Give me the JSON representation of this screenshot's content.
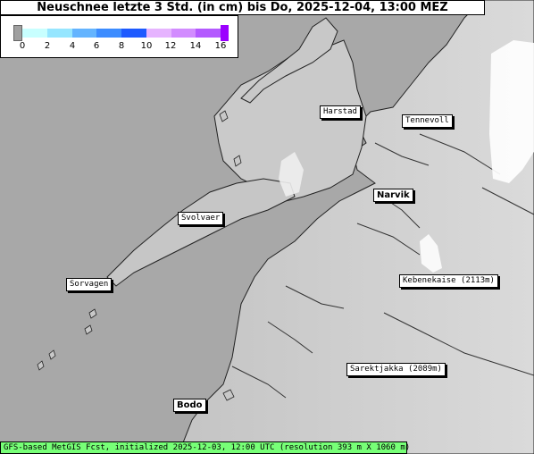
{
  "title": "Neuschnee letzte 3 Std. (in cm) bis Do, 2025-12-04, 13:00 MEZ",
  "legend": {
    "ticks": [
      "0",
      "2",
      "4",
      "6",
      "8",
      "10",
      "12",
      "14",
      "16"
    ],
    "colors": [
      "#c8ffff",
      "#96e6ff",
      "#64b4ff",
      "#3c8cff",
      "#1e5aff",
      "#e6b4ff",
      "#d28cff",
      "#b45aff",
      "#9b00ff"
    ]
  },
  "places": {
    "harstad": "Harstad",
    "tennevoll": "Tennevoll",
    "narvik": "Narvik",
    "svolvaer": "Svolvaer",
    "sorvagen": "Sorvagen",
    "kebnekaise": "Kebenekaise (2113m)",
    "sarektjakka": "Sarektjakka (2089m)",
    "bodo": "Bodo"
  },
  "footer": "GFS-based MetGIS Fcst, initialized 2025-12-03, 12:00 UTC  (resolution 393 m X 1060 m)",
  "colors": {
    "sea": "#a8a8a8",
    "land": "#cfcfcf",
    "snow": "#ffffff",
    "footer_bg": "#77ff77"
  }
}
